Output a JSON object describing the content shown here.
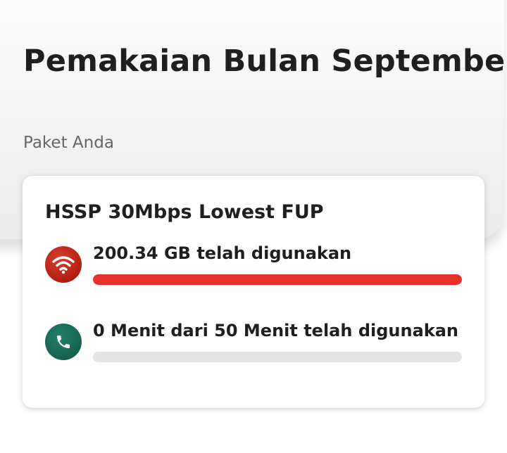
{
  "page": {
    "title": "Pemakaian Bulan September",
    "section_label": "Paket Anda"
  },
  "plan": {
    "name": "HSSP 30Mbps Lowest FUP",
    "usage": [
      {
        "id": "data",
        "icon": "wifi-icon",
        "text": "200.34 GB telah digunakan",
        "progress_fraction": 1.0,
        "color": "#e8312a",
        "icon_color": "#b31d12"
      },
      {
        "id": "voice",
        "icon": "phone-icon",
        "text": "0 Menit dari 50 Menit telah digunakan",
        "progress_fraction": 0.0,
        "color": "#2a8a72",
        "icon_color": "#166150"
      }
    ]
  },
  "colors": {
    "track": "#e4e4e4",
    "title_text": "#1f1f1f",
    "label_text": "#666666"
  }
}
